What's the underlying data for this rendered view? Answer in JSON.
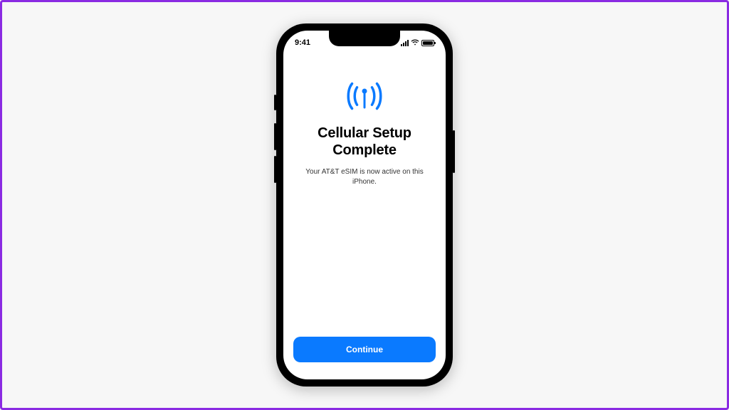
{
  "status": {
    "time": "9:41"
  },
  "content": {
    "title": "Cellular Setup\nComplete",
    "subtitle": "Your AT&T eSIM is now active on this iPhone."
  },
  "footer": {
    "continue_label": "Continue"
  },
  "colors": {
    "accent": "#0a7aff"
  }
}
